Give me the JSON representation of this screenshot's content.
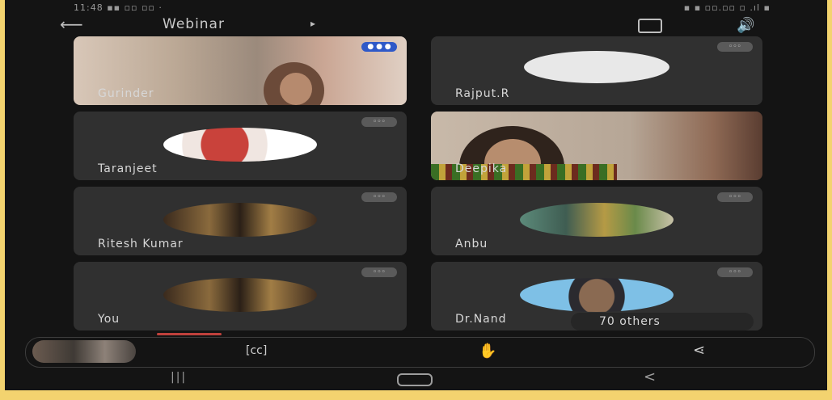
{
  "status_bar": {
    "left_text": "11:48 ▪▪ ▫▫ ▫▫ ·",
    "right_text": "▪ ▪ ▫▫.▫▫ ▫ .ıl ▪"
  },
  "top_bar": {
    "title": "Webinar",
    "title_chevron": "▸"
  },
  "participants": [
    {
      "name": "Gurinder",
      "badge": "● ● ●"
    },
    {
      "name": "Rajput.R",
      "badge": ""
    },
    {
      "name": "Taranjeet",
      "badge": ""
    },
    {
      "name": "Deepika",
      "badge": ""
    },
    {
      "name": "Ritesh Kumar",
      "badge": ""
    },
    {
      "name": "Anbu",
      "badge": ""
    },
    {
      "name": "You",
      "badge": ""
    },
    {
      "name": "Dr.Nand",
      "badge": ""
    }
  ],
  "others_label": "70 others",
  "bottom_bar": {
    "cc_label": "[cc]"
  },
  "nav": {
    "recents": "|||",
    "back": "<"
  },
  "colors": {
    "background": "#f3d36f",
    "screen": "#141414",
    "tile": "#303030",
    "recording": "#c1413c"
  }
}
